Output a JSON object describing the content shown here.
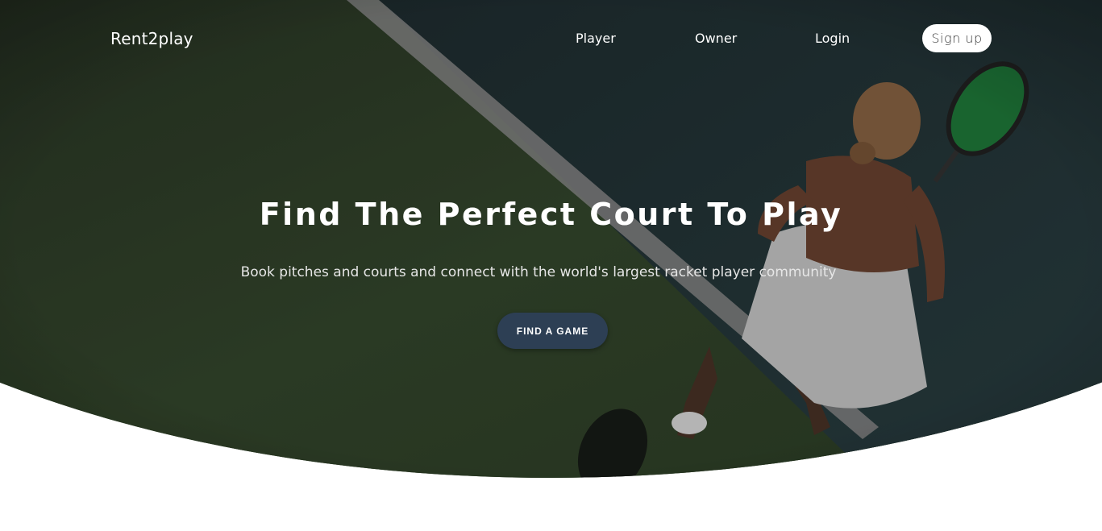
{
  "nav": {
    "logo": "Rent2play",
    "links": [
      "Player",
      "Owner",
      "Login"
    ],
    "signup_label": "Sign up"
  },
  "hero": {
    "title": "Find The Perfect Court To Play",
    "subtitle": "Book pitches and courts and connect with the world's largest racket player community",
    "cta_label": "FIND A GAME",
    "image_subject": "tennis-player-on-court-photo"
  },
  "colors": {
    "court_green": "#2f3d2a",
    "court_blue": "#25363a",
    "cta_background": "#2d3f54",
    "signup_background": "#ffffff",
    "page_background": "#ffffff"
  }
}
